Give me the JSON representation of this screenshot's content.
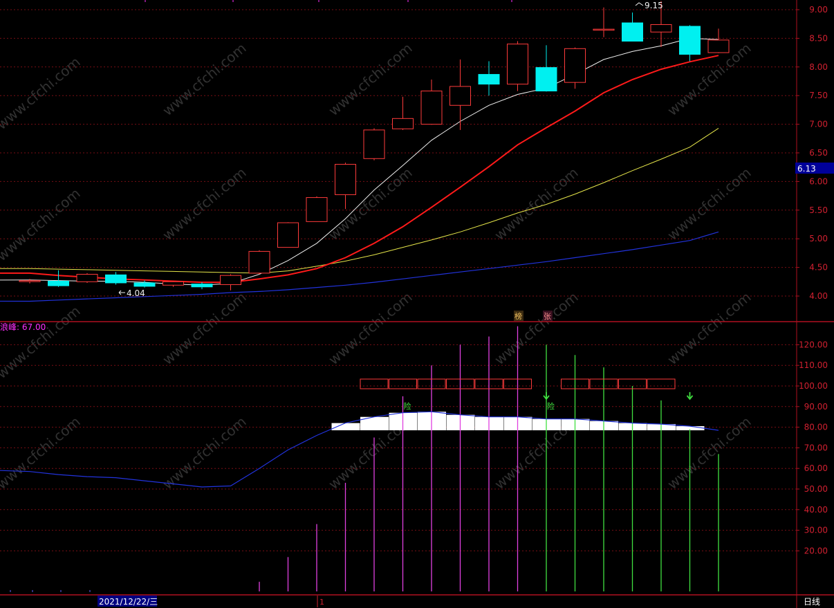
{
  "colors": {
    "background": "#000000",
    "frame": "#b01020",
    "grid": "#7a0e14",
    "axis_text": "#d02030",
    "up_candle": "#ff3b3b",
    "down_candle": "#00f0f0",
    "ma_fast": "#f0f0f0",
    "ma_mid": "#ff1a1a",
    "ma_slow": "#e6e64a",
    "ma_long": "#2233dd",
    "bar_purple": "#e040e0",
    "bar_green": "#40e040",
    "label_magenta": "#ff30ff",
    "current_price_bg": "#000099",
    "watermark": "#5a5a5a"
  },
  "watermark_text": "www.cfchi.com",
  "price_panel": {
    "current_price_label": "6.13",
    "high_annotation": "9.15",
    "low_annotation": "4.04",
    "event_badges": [
      "榜",
      "张"
    ]
  },
  "indicator_panel": {
    "label": "浪峰: 67.00",
    "signal_text": "险"
  },
  "footer": {
    "date_label": "2021/12/22/三",
    "marker": "1",
    "period_label": "日线"
  },
  "chart_data": [
    {
      "type": "candlestick",
      "y_ticks": [
        "9.00",
        "8.50",
        "8.00",
        "7.50",
        "7.00",
        "6.50",
        "6.00",
        "5.50",
        "5.00",
        "4.50",
        "4.00"
      ],
      "ylim": [
        3.63,
        9.25
      ],
      "candles": [
        {
          "o": 4.27,
          "h": 4.3,
          "l": 4.22,
          "c": 4.27
        },
        {
          "o": 4.26,
          "h": 4.45,
          "l": 4.16,
          "c": 4.18
        },
        {
          "o": 4.25,
          "h": 4.4,
          "l": 4.23,
          "c": 4.38
        },
        {
          "o": 4.37,
          "h": 4.42,
          "l": 4.2,
          "c": 4.23
        },
        {
          "o": 4.23,
          "h": 4.27,
          "l": 4.15,
          "c": 4.17
        },
        {
          "o": 4.19,
          "h": 4.26,
          "l": 4.16,
          "c": 4.25
        },
        {
          "o": 4.21,
          "h": 4.24,
          "l": 4.12,
          "c": 4.16
        },
        {
          "o": 4.2,
          "h": 4.38,
          "l": 4.1,
          "c": 4.36
        },
        {
          "o": 4.4,
          "h": 4.8,
          "l": 4.38,
          "c": 4.78
        },
        {
          "o": 4.85,
          "h": 5.29,
          "l": 4.85,
          "c": 5.28
        },
        {
          "o": 5.3,
          "h": 5.74,
          "l": 5.3,
          "c": 5.72
        },
        {
          "o": 5.77,
          "h": 6.33,
          "l": 5.52,
          "c": 6.3
        },
        {
          "o": 6.4,
          "h": 6.93,
          "l": 6.37,
          "c": 6.9
        },
        {
          "o": 6.92,
          "h": 7.48,
          "l": 6.9,
          "c": 7.1
        },
        {
          "o": 7.0,
          "h": 7.78,
          "l": 6.99,
          "c": 7.58
        },
        {
          "o": 7.33,
          "h": 8.13,
          "l": 6.9,
          "c": 7.66
        },
        {
          "o": 7.87,
          "h": 8.1,
          "l": 7.5,
          "c": 7.7
        },
        {
          "o": 7.7,
          "h": 8.45,
          "l": 7.58,
          "c": 8.4
        },
        {
          "o": 7.99,
          "h": 8.38,
          "l": 7.57,
          "c": 7.58
        },
        {
          "o": 7.73,
          "h": 8.34,
          "l": 7.62,
          "c": 8.32
        },
        {
          "o": 8.66,
          "h": 9.04,
          "l": 8.52,
          "c": 8.66
        },
        {
          "o": 8.77,
          "h": 8.95,
          "l": 8.45,
          "c": 8.45
        },
        {
          "o": 8.61,
          "h": 9.15,
          "l": 8.35,
          "c": 8.74
        },
        {
          "o": 8.71,
          "h": 8.73,
          "l": 8.1,
          "c": 8.22
        },
        {
          "o": 8.25,
          "h": 8.67,
          "l": 8.24,
          "c": 8.47
        }
      ],
      "ma_fast": [
        4.28,
        4.27,
        4.26,
        4.26,
        4.24,
        4.21,
        4.19,
        4.22,
        4.38,
        4.62,
        4.92,
        5.35,
        5.85,
        6.28,
        6.72,
        7.05,
        7.33,
        7.52,
        7.63,
        7.87,
        8.13,
        8.27,
        8.37,
        8.5,
        8.48
      ],
      "ma_mid": [
        4.4,
        4.36,
        4.33,
        4.3,
        4.28,
        4.26,
        4.24,
        4.24,
        4.3,
        4.37,
        4.48,
        4.67,
        4.92,
        5.21,
        5.55,
        5.9,
        6.26,
        6.64,
        6.94,
        7.23,
        7.55,
        7.78,
        7.96,
        8.09,
        8.2
      ],
      "ma_slow": [
        4.48,
        4.47,
        4.46,
        4.45,
        4.44,
        4.43,
        4.42,
        4.41,
        4.4,
        4.44,
        4.52,
        4.61,
        4.72,
        4.85,
        4.98,
        5.12,
        5.28,
        5.45,
        5.6,
        5.78,
        5.98,
        6.19,
        6.39,
        6.6,
        6.93
      ],
      "ma_long": [
        3.91,
        3.93,
        3.95,
        3.97,
        3.99,
        4.01,
        4.03,
        4.06,
        4.08,
        4.11,
        4.15,
        4.19,
        4.24,
        4.3,
        4.36,
        4.42,
        4.48,
        4.54,
        4.6,
        4.67,
        4.74,
        4.81,
        4.89,
        4.97,
        5.12
      ]
    },
    {
      "type": "bar",
      "y_ticks": [
        "120.00",
        "110.00",
        "100.00",
        "90.00",
        "80.00",
        "70.00",
        "60.00",
        "50.00",
        "40.00",
        "30.00",
        "20.00"
      ],
      "ylim": [
        0,
        126
      ],
      "bar_values": [
        0,
        0,
        0,
        0,
        0,
        0,
        0,
        0,
        5,
        17,
        33,
        53,
        75,
        95,
        110,
        120,
        124,
        129,
        120,
        115,
        109,
        100,
        93,
        79,
        67
      ],
      "bar_colors": [
        "purple",
        "purple",
        "purple",
        "purple",
        "purple",
        "purple",
        "purple",
        "purple",
        "purple",
        "purple",
        "purple",
        "purple",
        "purple",
        "purple",
        "purple",
        "purple",
        "purple",
        "purple",
        "green",
        "green",
        "green",
        "green",
        "green",
        "green",
        "green"
      ],
      "line_values": [
        58.5,
        57.0,
        56.0,
        55.5,
        54.0,
        52.5,
        51.0,
        51.5,
        60.0,
        69.0,
        76.0,
        82.0,
        85.0,
        87.0,
        87.5,
        86.0,
        85.0,
        85.0,
        84.0,
        84.0,
        83.0,
        82.0,
        81.5,
        80.5,
        78.5
      ],
      "box_value": 101,
      "box_slots": [
        12,
        13,
        14,
        15,
        16,
        17,
        19,
        20,
        21,
        22
      ],
      "white_fill_from": 10,
      "white_fill_to": 23,
      "signal_slots": [
        13,
        18
      ],
      "arrow_slots": [
        18,
        23
      ]
    }
  ]
}
